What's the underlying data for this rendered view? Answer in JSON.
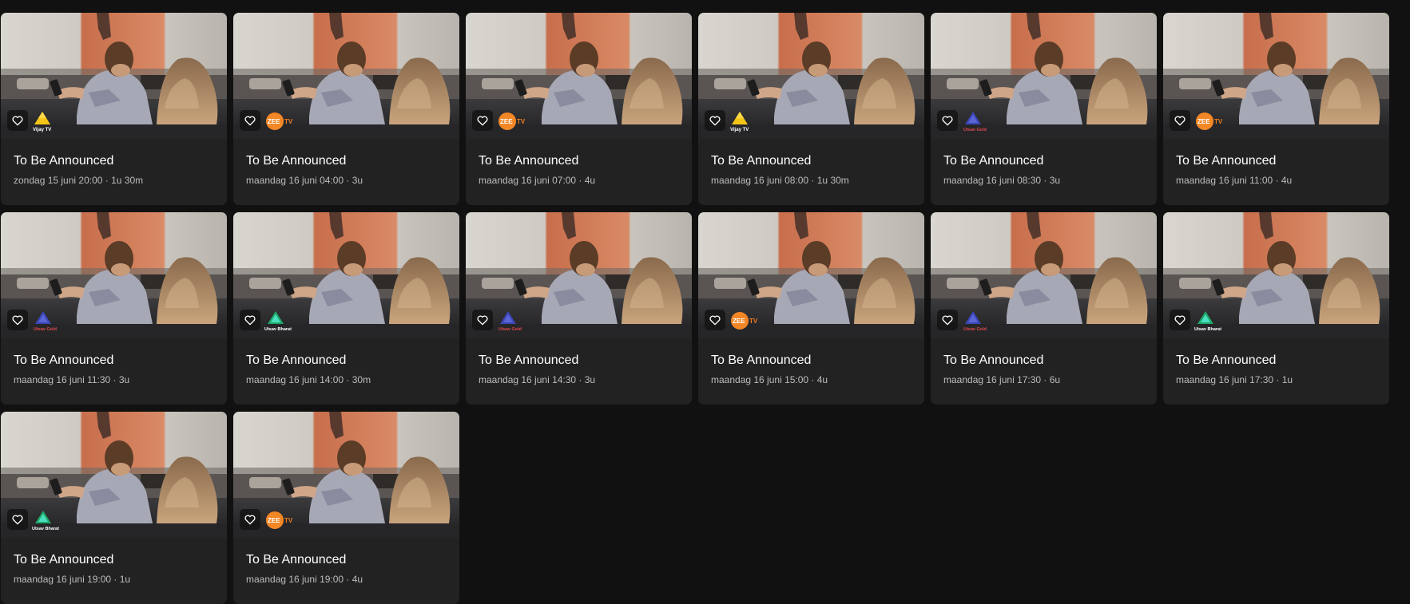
{
  "programs": [
    {
      "title": "To Be Announced",
      "meta": "zondag 15 juni 20:00 · 1u 30m",
      "channel": "Vijay TV",
      "channel_logo": "vijay-tv-logo"
    },
    {
      "title": "To Be Announced",
      "meta": "maandag 16 juni 04:00 · 3u",
      "channel": "ZEE TV",
      "channel_logo": "zee-tv-logo"
    },
    {
      "title": "To Be Announced",
      "meta": "maandag 16 juni 07:00 · 4u",
      "channel": "ZEE TV",
      "channel_logo": "zee-tv-logo"
    },
    {
      "title": "To Be Announced",
      "meta": "maandag 16 juni 08:00 · 1u 30m",
      "channel": "Vijay TV",
      "channel_logo": "vijay-tv-logo"
    },
    {
      "title": "To Be Announced",
      "meta": "maandag 16 juni 08:30 · 3u",
      "channel": "Utsav Gold",
      "channel_logo": "utsav-gold-logo"
    },
    {
      "title": "To Be Announced",
      "meta": "maandag 16 juni 11:00 · 4u",
      "channel": "ZEE TV",
      "channel_logo": "zee-tv-logo"
    },
    {
      "title": "To Be Announced",
      "meta": "maandag 16 juni 11:30 · 3u",
      "channel": "Utsav Gold",
      "channel_logo": "utsav-gold-logo"
    },
    {
      "title": "To Be Announced",
      "meta": "maandag 16 juni 14:00 · 30m",
      "channel": "Utsav Bharat",
      "channel_logo": "utsav-bharat-logo"
    },
    {
      "title": "To Be Announced",
      "meta": "maandag 16 juni 14:30 · 3u",
      "channel": "Utsav Gold",
      "channel_logo": "utsav-gold-logo"
    },
    {
      "title": "To Be Announced",
      "meta": "maandag 16 juni 15:00 · 4u",
      "channel": "ZEE TV",
      "channel_logo": "zee-tv-logo"
    },
    {
      "title": "To Be Announced",
      "meta": "maandag 16 juni 17:30 · 6u",
      "channel": "Utsav Gold",
      "channel_logo": "utsav-gold-logo"
    },
    {
      "title": "To Be Announced",
      "meta": "maandag 16 juni 17:30 · 1u",
      "channel": "Utsav Bharat",
      "channel_logo": "utsav-bharat-logo"
    },
    {
      "title": "To Be Announced",
      "meta": "maandag 16 juni 19:00 · 1u",
      "channel": "Utsav Bharat",
      "channel_logo": "utsav-bharat-logo"
    },
    {
      "title": "To Be Announced",
      "meta": "maandag 16 juni 19:00 · 4u",
      "channel": "ZEE TV",
      "channel_logo": "zee-tv-logo"
    }
  ],
  "icons": {
    "favorite": "heart-outline-icon"
  },
  "colors": {
    "background": "#111111",
    "card": "#222222",
    "title": "#ffffff",
    "meta": "#bdbdbd"
  }
}
